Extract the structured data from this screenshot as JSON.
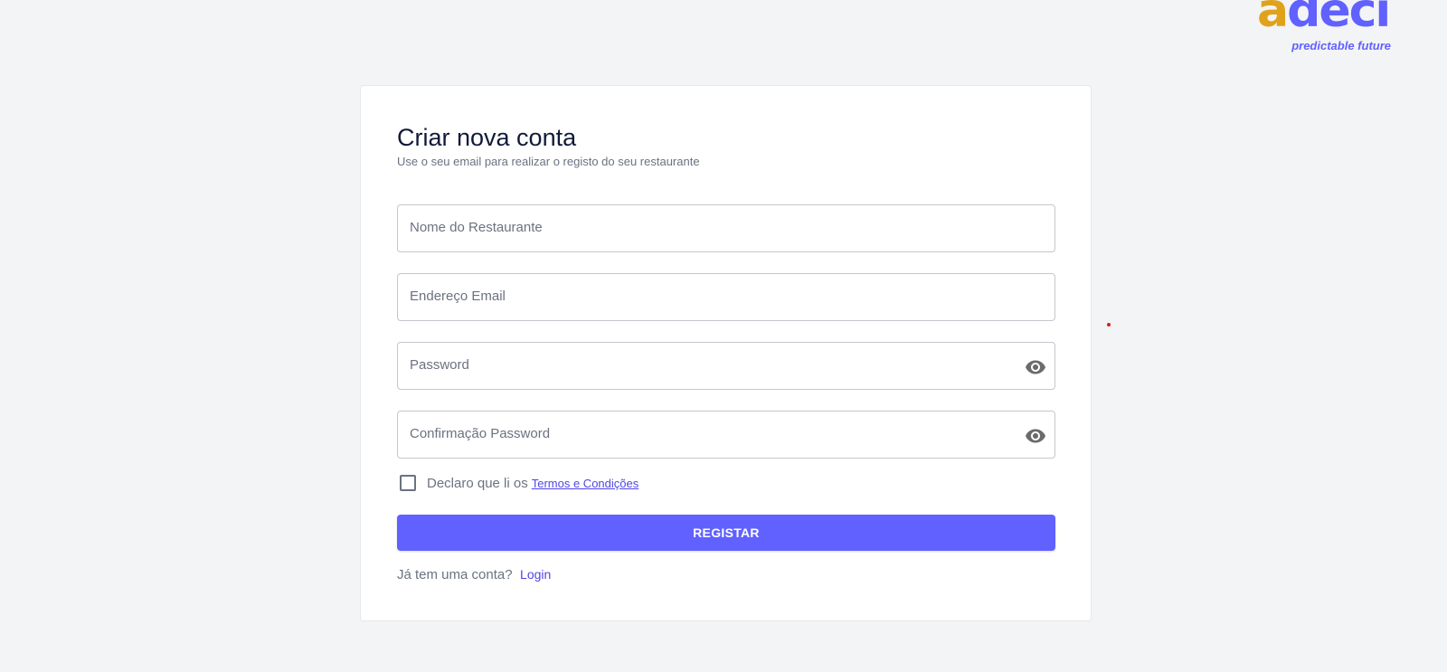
{
  "logo": {
    "letter_a": "a",
    "letters_rest": "deci",
    "tagline": "predictable future",
    "color_a": "#e0a21b",
    "color_rest": "#6161ff"
  },
  "form": {
    "title": "Criar nova conta",
    "subtitle": "Use o seu email para realizar o registo do seu restaurante",
    "fields": {
      "restaurant_name": {
        "value": "",
        "placeholder": "Nome do Restaurante"
      },
      "email": {
        "value": "",
        "placeholder": "Endereço Email"
      },
      "password": {
        "value": "",
        "placeholder": "Password",
        "icon": "eye-icon"
      },
      "password_confirm": {
        "value": "",
        "placeholder": "Confirmação Password",
        "icon": "eye-icon"
      }
    },
    "terms": {
      "checked": false,
      "text": "Declaro que li os",
      "link": "Termos e Condições"
    },
    "submit_label": "REGISTAR",
    "login": {
      "text": "Já tem uma conta?",
      "link": "Login"
    }
  },
  "colors": {
    "accent": "#6161ff",
    "link": "#4f46e5",
    "background": "#f3f4f6"
  }
}
